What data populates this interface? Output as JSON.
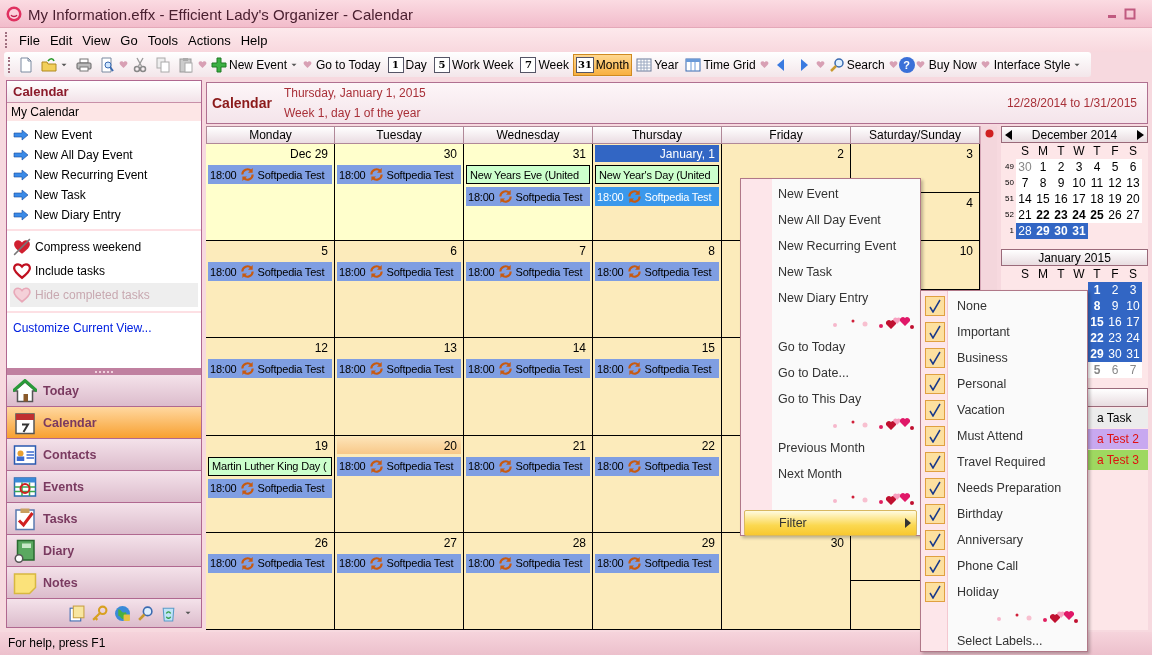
{
  "window": {
    "title": "My Information.effx - Efficient Lady's Organizer - Calendar"
  },
  "menu_bar": [
    "File",
    "Edit",
    "View",
    "Go",
    "Tools",
    "Actions",
    "Help"
  ],
  "toolbar": [
    {
      "kind": "doc"
    },
    {
      "kind": "folder",
      "dropdown": true
    },
    {
      "kind": "printer"
    },
    {
      "kind": "preview"
    },
    {
      "kind": "sep"
    },
    {
      "kind": "scissors"
    },
    {
      "kind": "copy"
    },
    {
      "kind": "paste"
    },
    {
      "kind": "sep"
    },
    {
      "kind": "plus",
      "label": "New Event",
      "dropdown": true
    },
    {
      "kind": "sep"
    },
    {
      "kind": "text",
      "label": "Go to Today"
    },
    {
      "kind": "page",
      "badge": "1",
      "label": "Day",
      "selected": false
    },
    {
      "kind": "page",
      "badge": "5",
      "label": "Work Week",
      "selected": false
    },
    {
      "kind": "page",
      "badge": "7",
      "label": "Week",
      "selected": false
    },
    {
      "kind": "page",
      "badge": "31",
      "label": "Month",
      "selected": true
    },
    {
      "kind": "grid",
      "label": "Year",
      "selected": false
    },
    {
      "kind": "columns",
      "label": "Time Grid",
      "selected": false
    },
    {
      "kind": "sep"
    },
    {
      "kind": "back"
    },
    {
      "kind": "forward"
    },
    {
      "kind": "sep"
    },
    {
      "kind": "search",
      "label": "Search"
    },
    {
      "kind": "sep"
    },
    {
      "kind": "help",
      "glyph": "?"
    },
    {
      "kind": "sep"
    },
    {
      "kind": "text",
      "label": "Buy Now"
    },
    {
      "kind": "sep"
    },
    {
      "kind": "text",
      "label": "Interface Style",
      "dropdown": true
    }
  ],
  "side_panel": {
    "title": "Calendar",
    "calendar": "My Calendar",
    "tasks": [
      "New Event",
      "New All Day Event",
      "New Recurring Event",
      "New Task",
      "New Diary Entry"
    ],
    "options": [
      {
        "label": "Compress weekend",
        "kind": "arrowheart",
        "disabled": false
      },
      {
        "label": "Include tasks",
        "kind": "heart",
        "disabled": false
      },
      {
        "label": "Hide completed tasks",
        "kind": "heart",
        "disabled": true
      }
    ],
    "link": "Customize Current View..."
  },
  "nav": [
    {
      "label": "Today",
      "kind": "house",
      "selected": false
    },
    {
      "label": "Calendar",
      "kind": "calendar",
      "selected": true
    },
    {
      "label": "Contacts",
      "kind": "contacts",
      "selected": false
    },
    {
      "label": "Events",
      "kind": "events",
      "selected": false
    },
    {
      "label": "Tasks",
      "kind": "tasks",
      "selected": false
    },
    {
      "label": "Diary",
      "kind": "diary",
      "selected": false
    },
    {
      "label": "Notes",
      "kind": "notes",
      "selected": false
    }
  ],
  "nav_tools": [
    {
      "kind": "clip"
    },
    {
      "kind": "key"
    },
    {
      "kind": "globe"
    },
    {
      "kind": "magnifier"
    },
    {
      "kind": "bin"
    },
    {
      "kind": "caret"
    }
  ],
  "calendar": {
    "title": "Calendar",
    "date": "Thursday, January 1, 2015",
    "week": "Week 1, day 1 of the year",
    "range": "12/28/2014 to 1/31/2015",
    "columns": [
      "Monday",
      "Tuesday",
      "Wednesday",
      "Thursday",
      "Friday",
      "Saturday/Sunday"
    ],
    "weeks": [
      {
        "days": [
          {
            "date": "Dec 29",
            "other_month": true,
            "kind": "plain",
            "events": [
              {
                "kind": "recurring",
                "time": "18:00",
                "title": "Softpedia Test",
                "selected": false
              }
            ]
          },
          {
            "date": "30",
            "other_month": true,
            "kind": "plain",
            "events": [
              {
                "kind": "recurring",
                "time": "18:00",
                "title": "Softpedia Test",
                "selected": false
              }
            ]
          },
          {
            "date": "31",
            "other_month": true,
            "kind": "plain",
            "events": [
              {
                "kind": "allday",
                "title": "New Years Eve (United",
                "selected": false
              },
              {
                "kind": "recurring",
                "time": "18:00",
                "title": "Softpedia Test",
                "selected": false
              }
            ]
          },
          {
            "date": "January, 1",
            "other_month": false,
            "kind": "today",
            "events": [
              {
                "kind": "allday",
                "title": "New Year's Day (United",
                "selected": false
              },
              {
                "kind": "recurring",
                "time": "18:00",
                "title": "Softpedia Test",
                "selected": true
              }
            ]
          },
          {
            "date": "2",
            "other_month": false,
            "kind": "plain"
          }
        ],
        "weekend": [
          {
            "date": "3",
            "other_month": false,
            "kind": "plain"
          },
          {
            "date": "4",
            "other_month": false,
            "kind": "plain"
          }
        ]
      },
      {
        "days": [
          {
            "date": "5",
            "other_month": false,
            "kind": "plain",
            "events": [
              {
                "kind": "recurring",
                "time": "18:00",
                "title": "Softpedia Test",
                "selected": false
              }
            ]
          },
          {
            "date": "6",
            "other_month": false,
            "kind": "plain",
            "events": [
              {
                "kind": "recurring",
                "time": "18:00",
                "title": "Softpedia Test",
                "selected": false
              }
            ]
          },
          {
            "date": "7",
            "other_month": false,
            "kind": "plain",
            "events": [
              {
                "kind": "recurring",
                "time": "18:00",
                "title": "Softpedia Test",
                "selected": false
              }
            ]
          },
          {
            "date": "8",
            "other_month": false,
            "kind": "plain",
            "events": [
              {
                "kind": "recurring",
                "time": "18:00",
                "title": "Softpedia Test",
                "selected": false
              }
            ]
          },
          {
            "other_month": false
          }
        ],
        "weekend": [
          {
            "date": "10",
            "other_month": false,
            "kind": "plain"
          }
        ]
      },
      {
        "days": [
          {
            "date": "12",
            "other_month": false,
            "kind": "plain",
            "events": [
              {
                "kind": "recurring",
                "time": "18:00",
                "title": "Softpedia Test",
                "selected": false
              }
            ]
          },
          {
            "date": "13",
            "other_month": false,
            "kind": "plain",
            "events": [
              {
                "kind": "recurring",
                "time": "18:00",
                "title": "Softpedia Test",
                "selected": false
              }
            ]
          },
          {
            "date": "14",
            "other_month": false,
            "kind": "plain",
            "events": [
              {
                "kind": "recurring",
                "time": "18:00",
                "title": "Softpedia Test",
                "selected": false
              }
            ]
          },
          {
            "date": "15",
            "other_month": false,
            "kind": "plain",
            "events": [
              {
                "kind": "recurring",
                "time": "18:00",
                "title": "Softpedia Test",
                "selected": false
              }
            ]
          },
          {
            "other_month": false
          }
        ]
      },
      {
        "days": [
          {
            "date": "19",
            "other_month": false,
            "kind": "plain",
            "events": [
              {
                "kind": "allday",
                "title": "Martin Luther King Day (",
                "selected": false
              },
              {
                "kind": "recurring",
                "time": "18:00",
                "title": "Softpedia Test",
                "selected": false
              }
            ]
          },
          {
            "date": "20",
            "other_month": false,
            "kind": "hover",
            "events": [
              {
                "kind": "recurring",
                "time": "18:00",
                "title": "Softpedia Test",
                "selected": false
              }
            ]
          },
          {
            "date": "21",
            "other_month": false,
            "kind": "plain",
            "events": [
              {
                "kind": "recurring",
                "time": "18:00",
                "title": "Softpedia Test",
                "selected": false
              }
            ]
          },
          {
            "date": "22",
            "other_month": false,
            "kind": "plain",
            "events": [
              {
                "kind": "recurring",
                "time": "18:00",
                "title": "Softpedia Test",
                "selected": false
              }
            ]
          },
          {
            "other_month": false
          }
        ]
      },
      {
        "days": [
          {
            "date": "26",
            "other_month": false,
            "kind": "plain",
            "events": [
              {
                "kind": "recurring",
                "time": "18:00",
                "title": "Softpedia Test",
                "selected": false
              }
            ]
          },
          {
            "date": "27",
            "other_month": false,
            "kind": "plain",
            "events": [
              {
                "kind": "recurring",
                "time": "18:00",
                "title": "Softpedia Test",
                "selected": false
              }
            ]
          },
          {
            "date": "28",
            "other_month": false,
            "kind": "plain",
            "events": [
              {
                "kind": "recurring",
                "time": "18:00",
                "title": "Softpedia Test",
                "selected": false
              }
            ]
          },
          {
            "date": "29",
            "other_month": false,
            "kind": "plain",
            "events": [
              {
                "kind": "recurring",
                "time": "18:00",
                "title": "Softpedia Test",
                "selected": false
              }
            ]
          },
          {
            "date": "30",
            "other_month": false,
            "kind": "plain"
          }
        ],
        "weekend": [
          {
            "other_month": false
          },
          {
            "other_month": false
          }
        ]
      }
    ]
  },
  "mini_calendars": [
    {
      "title": "December 2014",
      "nav": true,
      "covered_left": false,
      "weekdays": [
        "S",
        "M",
        "T",
        "W",
        "T",
        "F",
        "S"
      ],
      "weeks": [
        {
          "number": "49",
          "days": [
            {
              "day": "30",
              "other_month": true,
              "bold": false,
              "selected": false
            },
            {
              "day": "1",
              "other_month": false,
              "bold": false,
              "selected": false
            },
            {
              "day": "2",
              "other_month": false,
              "bold": false,
              "selected": false
            },
            {
              "day": "3",
              "other_month": false,
              "bold": false,
              "selected": false
            },
            {
              "day": "4",
              "other_month": false,
              "bold": false,
              "selected": false
            },
            {
              "day": "5",
              "other_month": false,
              "bold": false,
              "selected": false
            },
            {
              "day": "6",
              "other_month": false,
              "bold": false,
              "selected": false
            }
          ]
        },
        {
          "number": "50",
          "days": [
            {
              "day": "7",
              "other_month": false,
              "bold": false,
              "selected": false
            },
            {
              "day": "8",
              "other_month": false,
              "bold": false,
              "selected": false
            },
            {
              "day": "9",
              "other_month": false,
              "bold": false,
              "selected": false
            },
            {
              "day": "10",
              "other_month": false,
              "bold": false,
              "selected": false
            },
            {
              "day": "11",
              "other_month": false,
              "bold": false,
              "selected": false
            },
            {
              "day": "12",
              "other_month": false,
              "bold": false,
              "selected": false
            },
            {
              "day": "13",
              "other_month": false,
              "bold": false,
              "selected": false
            }
          ]
        },
        {
          "number": "51",
          "days": [
            {
              "day": "14",
              "other_month": false,
              "bold": false,
              "selected": false
            },
            {
              "day": "15",
              "other_month": false,
              "bold": false,
              "selected": false
            },
            {
              "day": "16",
              "other_month": false,
              "bold": false,
              "selected": false
            },
            {
              "day": "17",
              "other_month": false,
              "bold": false,
              "selected": false
            },
            {
              "day": "18",
              "other_month": false,
              "bold": false,
              "selected": false
            },
            {
              "day": "19",
              "other_month": false,
              "bold": false,
              "selected": false
            },
            {
              "day": "20",
              "other_month": false,
              "bold": false,
              "selected": false
            }
          ]
        },
        {
          "number": "52",
          "days": [
            {
              "day": "21",
              "other_month": false,
              "bold": false,
              "selected": false
            },
            {
              "day": "22",
              "other_month": false,
              "bold": true,
              "selected": false
            },
            {
              "day": "23",
              "other_month": false,
              "bold": true,
              "selected": false
            },
            {
              "day": "24",
              "other_month": false,
              "bold": true,
              "selected": false
            },
            {
              "day": "25",
              "other_month": false,
              "bold": true,
              "selected": false
            },
            {
              "day": "26",
              "other_month": false,
              "bold": false,
              "selected": false
            },
            {
              "day": "27",
              "other_month": false,
              "bold": false,
              "selected": false
            }
          ]
        },
        {
          "number": "1",
          "days": [
            {
              "day": "28",
              "other_month": false,
              "bold": false,
              "selected": true
            },
            {
              "day": "29",
              "other_month": false,
              "bold": true,
              "selected": true
            },
            {
              "day": "30",
              "other_month": false,
              "bold": true,
              "selected": true
            },
            {
              "day": "31",
              "other_month": false,
              "bold": true,
              "selected": true
            }
          ]
        }
      ]
    },
    {
      "title": "January 2015",
      "nav": false,
      "covered_left": true,
      "weekdays": [
        "S",
        "M",
        "T",
        "W",
        "T",
        "F",
        "S"
      ],
      "weeks": [
        {
          "days": [
            {
              "day": "1",
              "other_month": false,
              "bold": true,
              "selected": true
            },
            {
              "day": "2",
              "other_month": false,
              "bold": false,
              "selected": true
            },
            {
              "day": "3",
              "other_month": false,
              "bold": false,
              "selected": true
            }
          ]
        },
        {
          "days": [
            {
              "day": "8",
              "other_month": false,
              "bold": true,
              "selected": true
            },
            {
              "day": "9",
              "other_month": false,
              "bold": false,
              "selected": true
            },
            {
              "day": "10",
              "other_month": false,
              "bold": false,
              "selected": true
            }
          ]
        },
        {
          "days": [
            {
              "day": "15",
              "other_month": false,
              "bold": true,
              "selected": true
            },
            {
              "day": "16",
              "other_month": false,
              "bold": false,
              "selected": true
            },
            {
              "day": "17",
              "other_month": false,
              "bold": false,
              "selected": true
            }
          ]
        },
        {
          "days": [
            {
              "day": "22",
              "other_month": false,
              "bold": true,
              "selected": true
            },
            {
              "day": "23",
              "other_month": false,
              "bold": false,
              "selected": true
            },
            {
              "day": "24",
              "other_month": false,
              "bold": false,
              "selected": true
            }
          ]
        },
        {
          "days": [
            {
              "day": "29",
              "other_month": false,
              "bold": true,
              "selected": true
            },
            {
              "day": "30",
              "other_month": false,
              "bold": false,
              "selected": true
            },
            {
              "day": "31",
              "other_month": false,
              "bold": false,
              "selected": true
            }
          ]
        },
        {
          "days": [
            {
              "day": "5",
              "other_month": true,
              "bold": true,
              "selected": false
            },
            {
              "day": "6",
              "other_month": true,
              "bold": false,
              "selected": false
            },
            {
              "day": "7",
              "other_month": true,
              "bold": false,
              "selected": false
            }
          ]
        }
      ]
    }
  ],
  "task_list": {
    "items": [
      {
        "title": "a Task",
        "color": "#ececec",
        "overdue": false
      },
      {
        "title": "a Test 2",
        "color": "#c8a8f0",
        "overdue": true
      },
      {
        "title": "a Test 3",
        "color": "#9ed860",
        "overdue": true
      }
    ]
  },
  "context_menu": {
    "items": [
      {
        "kind": "item",
        "label": "New Event",
        "selected": false
      },
      {
        "kind": "item",
        "label": "New All Day Event",
        "selected": false
      },
      {
        "kind": "item",
        "label": "New Recurring Event",
        "selected": false
      },
      {
        "kind": "item",
        "label": "New Task",
        "selected": false
      },
      {
        "kind": "item",
        "label": "New Diary Entry",
        "selected": false
      },
      {
        "kind": "separator"
      },
      {
        "kind": "item",
        "label": "Go to Today",
        "selected": false
      },
      {
        "kind": "item",
        "label": "Go to Date...",
        "selected": false
      },
      {
        "kind": "item",
        "label": "Go to This Day",
        "selected": false
      },
      {
        "kind": "separator"
      },
      {
        "kind": "item",
        "label": "Previous Month",
        "selected": false
      },
      {
        "kind": "item",
        "label": "Next Month",
        "selected": false
      },
      {
        "kind": "separator"
      },
      {
        "kind": "submenu",
        "label": "Filter",
        "selected": true
      }
    ]
  },
  "filter_menu": {
    "items": [
      {
        "kind": "check",
        "label": "None",
        "checked": true
      },
      {
        "kind": "check",
        "label": "Important",
        "checked": true
      },
      {
        "kind": "check",
        "label": "Business",
        "checked": true
      },
      {
        "kind": "check",
        "label": "Personal",
        "checked": true
      },
      {
        "kind": "check",
        "label": "Vacation",
        "checked": true
      },
      {
        "kind": "check",
        "label": "Must Attend",
        "checked": true
      },
      {
        "kind": "check",
        "label": "Travel Required",
        "checked": true
      },
      {
        "kind": "check",
        "label": "Needs Preparation",
        "checked": true
      },
      {
        "kind": "check",
        "label": "Birthday",
        "checked": true
      },
      {
        "kind": "check",
        "label": "Anniversary",
        "checked": true
      },
      {
        "kind": "check",
        "label": "Phone Call",
        "checked": true
      },
      {
        "kind": "check",
        "label": "Holiday",
        "checked": true
      },
      {
        "kind": "separator"
      },
      {
        "kind": "item",
        "label": "Select Labels..."
      }
    ]
  },
  "status_bar": "For help, press F1"
}
